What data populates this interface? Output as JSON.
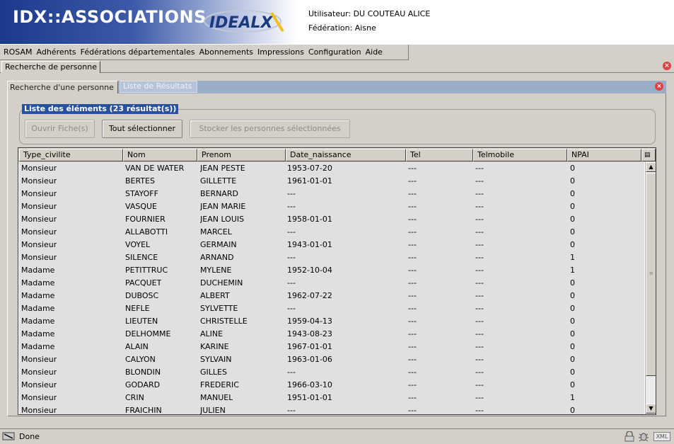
{
  "header": {
    "app_title": "IDX::ASSOCIATIONS",
    "logo_text": "IDEALX",
    "user_line": "Utilisateur: DU COUTEAU ALICE",
    "federation_line": "Fédération: Aisne"
  },
  "menubar": {
    "items": [
      "ROSAM",
      "Adhérents",
      "Fédérations départementales",
      "Abonnements",
      "Impressions",
      "Configuration",
      "Aide"
    ]
  },
  "outer_tab": {
    "label": "Recherche de personne"
  },
  "inner_tabs": {
    "active": "Recherche d'une personne",
    "inactive": "Liste de Résultats"
  },
  "group": {
    "legend": "Liste des éléments (23 résultat(s))",
    "buttons": {
      "open": "Ouvrir Fiche(s)",
      "select_all": "Tout sélectionner",
      "store": "Stocker les personnes sélectionnées"
    }
  },
  "table": {
    "columns": [
      "Type_civilite",
      "Nom",
      "Prenom",
      "Date_naissance",
      "Tel",
      "Telmobile",
      "NPAI"
    ],
    "rows": [
      [
        "Monsieur",
        "VAN DE WATER",
        "JEAN PESTE",
        "1953-07-20",
        "---",
        "---",
        "0"
      ],
      [
        "Monsieur",
        "BERTES",
        "GILLETTE",
        "1961-01-01",
        "---",
        "---",
        "0"
      ],
      [
        "Monsieur",
        "STAYOFF",
        "BERNARD",
        "---",
        "---",
        "---",
        "0"
      ],
      [
        "Monsieur",
        "VASQUE",
        "JEAN MARIE",
        "---",
        "---",
        "---",
        "0"
      ],
      [
        "Monsieur",
        "FOURNIER",
        "JEAN LOUIS",
        "1958-01-01",
        "---",
        "---",
        "0"
      ],
      [
        "Monsieur",
        "ALLABOTTI",
        "MARCEL",
        "---",
        "---",
        "---",
        "0"
      ],
      [
        "Monsieur",
        "VOYEL",
        "GERMAIN",
        "1943-01-01",
        "---",
        "---",
        "0"
      ],
      [
        "Monsieur",
        "SILENCE",
        "ARNAND",
        "---",
        "---",
        "---",
        "1"
      ],
      [
        "Madame",
        "PETITTRUC",
        "MYLENE",
        "1952-10-04",
        "---",
        "---",
        "1"
      ],
      [
        "Madame",
        "PACQUET",
        "DUCHEMIN",
        "---",
        "---",
        "---",
        "0"
      ],
      [
        "Madame",
        "DUBOSC",
        "ALBERT",
        "1962-07-22",
        "---",
        "---",
        "0"
      ],
      [
        "Madame",
        "NEFLE",
        "SYLVETTE",
        "---",
        "---",
        "---",
        "0"
      ],
      [
        "Madame",
        "LIEUTEN",
        "CHRISTELLE",
        "1959-04-13",
        "---",
        "---",
        "0"
      ],
      [
        "Madame",
        "DELHOMME",
        "ALINE",
        "1943-08-23",
        "---",
        "---",
        "0"
      ],
      [
        "Madame",
        "ALAIN",
        "KARINE",
        "1967-01-01",
        "---",
        "---",
        "0"
      ],
      [
        "Monsieur",
        "CALYON",
        "SYLVAIN",
        "1963-01-06",
        "---",
        "---",
        "0"
      ],
      [
        "Monsieur",
        "BLONDIN",
        "GILLES",
        "---",
        "---",
        "---",
        "0"
      ],
      [
        "Monsieur",
        "GODARD",
        "FREDERIC",
        "1966-03-10",
        "---",
        "---",
        "0"
      ],
      [
        "Monsieur",
        "CRIN",
        "MANUEL",
        "1951-01-01",
        "---",
        "---",
        "1"
      ],
      [
        "Monsieur",
        "FRAICHIN",
        "JULIEN",
        "---",
        "---",
        "---",
        "0"
      ]
    ]
  },
  "statusbar": {
    "text": "Done",
    "badge": "XML"
  },
  "colors": {
    "banner": "#1b3a8c",
    "legend_bg": "#2850a0",
    "close": "#e04040",
    "inner_header": "#9aacc8"
  }
}
